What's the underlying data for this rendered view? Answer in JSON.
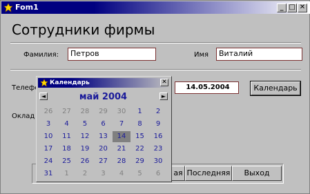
{
  "window": {
    "title": "Fom1"
  },
  "heading": "Сотрудники фирмы",
  "fields": {
    "surname_label": "Фамилия:",
    "surname_value": "Петров",
    "name_label": "Имя",
    "name_value": "Виталий",
    "phone_label": "Телефон",
    "salary_label": "Оклад",
    "date_value": "14.05.2004"
  },
  "buttons": {
    "calendar": "Календарь",
    "last": "Последняя",
    "exit": "Выход",
    "first_partial": "ая"
  },
  "calendar": {
    "title": "Календарь",
    "close": "✕",
    "prev": "◄",
    "next": "►",
    "month": "май 2004",
    "selected": 14,
    "rows": [
      [
        [
          "26",
          "o"
        ],
        [
          "27",
          "o"
        ],
        [
          "28",
          "o"
        ],
        [
          "29",
          "o"
        ],
        [
          "30",
          "o"
        ],
        [
          "1",
          "c"
        ],
        [
          "2",
          "c"
        ]
      ],
      [
        [
          "3",
          "c"
        ],
        [
          "4",
          "c"
        ],
        [
          "5",
          "c"
        ],
        [
          "6",
          "c"
        ],
        [
          "7",
          "c"
        ],
        [
          "8",
          "c"
        ],
        [
          "9",
          "c"
        ]
      ],
      [
        [
          "10",
          "c"
        ],
        [
          "11",
          "c"
        ],
        [
          "12",
          "c"
        ],
        [
          "13",
          "c"
        ],
        [
          "14",
          "s"
        ],
        [
          "15",
          "c"
        ],
        [
          "16",
          "c"
        ]
      ],
      [
        [
          "17",
          "c"
        ],
        [
          "18",
          "c"
        ],
        [
          "19",
          "c"
        ],
        [
          "20",
          "c"
        ],
        [
          "21",
          "c"
        ],
        [
          "22",
          "c"
        ],
        [
          "23",
          "c"
        ]
      ],
      [
        [
          "24",
          "c"
        ],
        [
          "25",
          "c"
        ],
        [
          "26",
          "c"
        ],
        [
          "27",
          "c"
        ],
        [
          "28",
          "c"
        ],
        [
          "29",
          "c"
        ],
        [
          "30",
          "c"
        ]
      ],
      [
        [
          "31",
          "c"
        ],
        [
          "1",
          "o"
        ],
        [
          "2",
          "o"
        ],
        [
          "3",
          "o"
        ],
        [
          "4",
          "o"
        ],
        [
          "5",
          "o"
        ],
        [
          "6",
          "o"
        ]
      ]
    ]
  }
}
